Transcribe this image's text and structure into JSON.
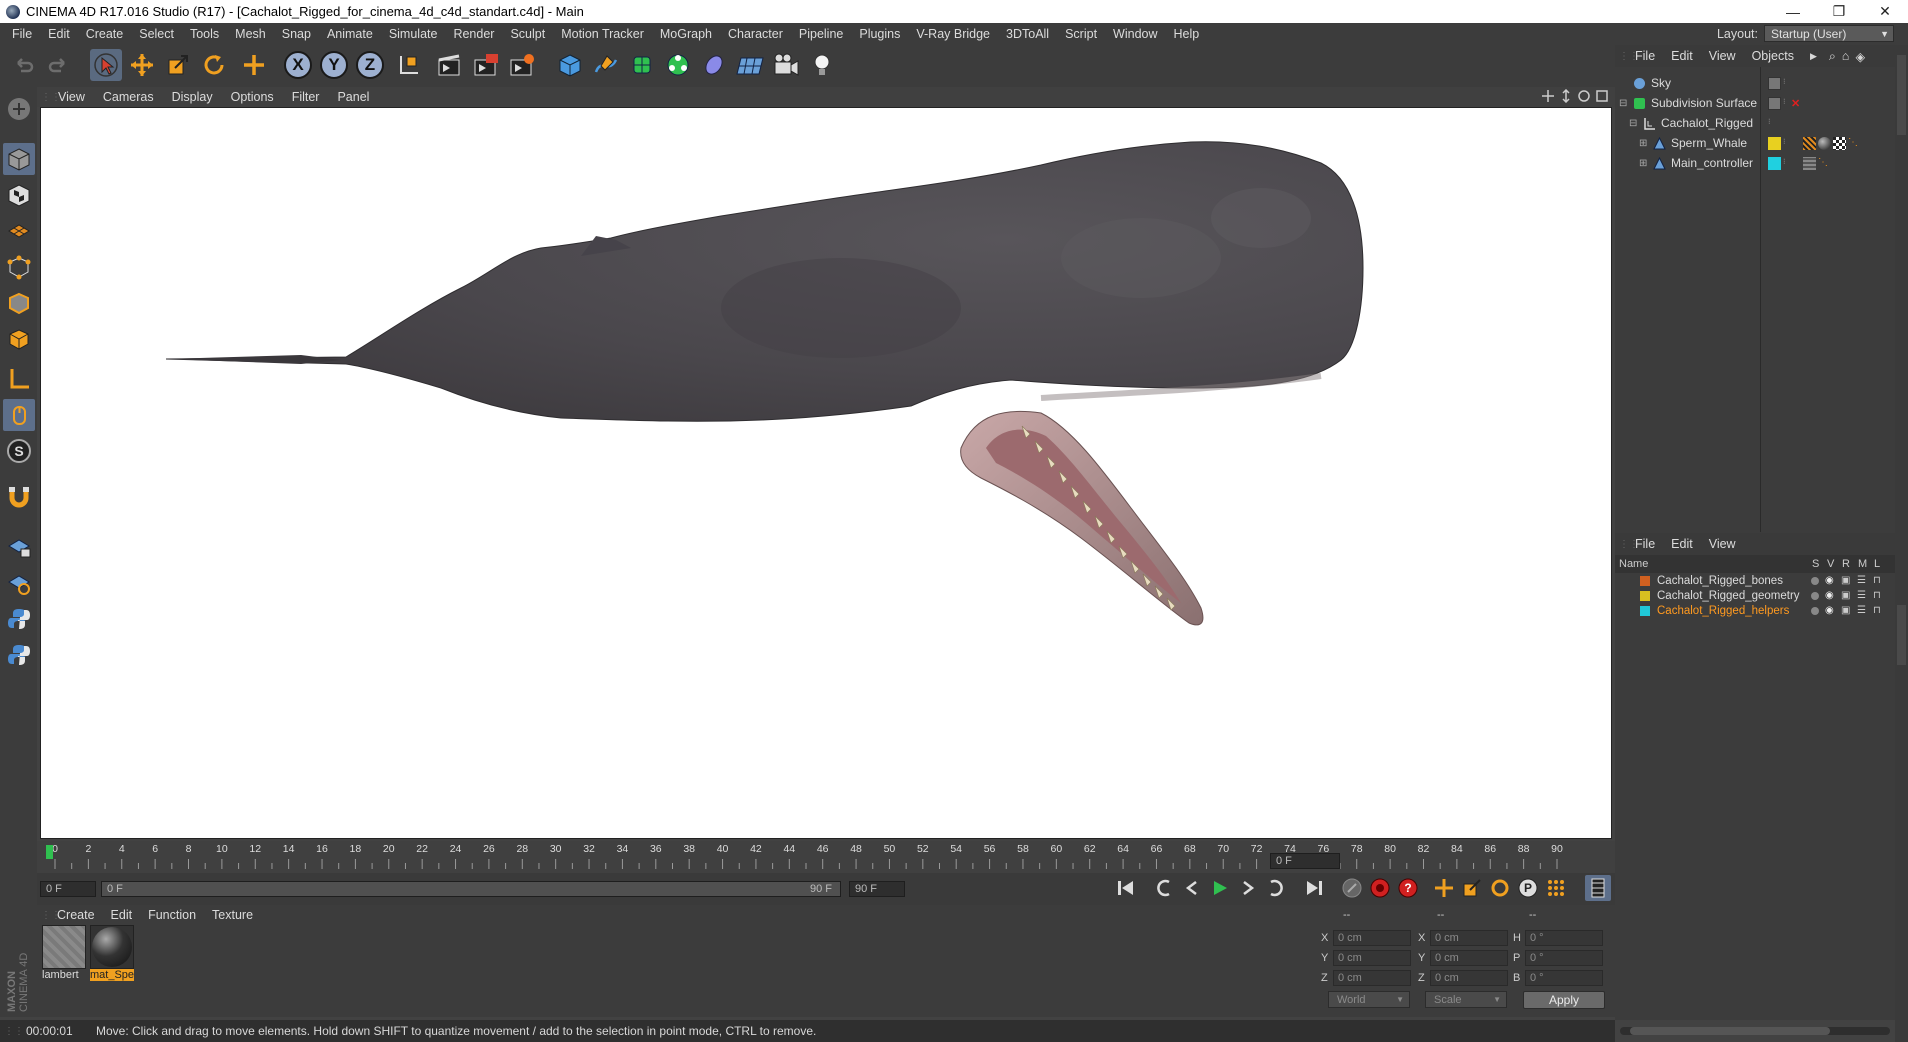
{
  "window": {
    "title": "CINEMA 4D R17.016 Studio (R17) - [Cachalot_Rigged_for_cinema_4d_c4d_standart.c4d] - Main",
    "min_glyph": "—",
    "restore_glyph": "❐",
    "close_glyph": "✕"
  },
  "menu": {
    "items": [
      "File",
      "Edit",
      "Create",
      "Select",
      "Tools",
      "Mesh",
      "Snap",
      "Animate",
      "Simulate",
      "Render",
      "Sculpt",
      "Motion Tracker",
      "MoGraph",
      "Character",
      "Pipeline",
      "Plugins",
      "V-Ray Bridge",
      "3DToAll",
      "Script",
      "Window",
      "Help"
    ],
    "layout_label": "Layout:",
    "layout_value": "Startup (User)"
  },
  "toolbar": {
    "axis_x": "X",
    "axis_y": "Y",
    "axis_z": "Z"
  },
  "viewport": {
    "menu": [
      "View",
      "Cameras",
      "Display",
      "Options",
      "Filter",
      "Panel"
    ]
  },
  "timeline": {
    "ticks": [
      "0",
      "2",
      "4",
      "6",
      "8",
      "10",
      "12",
      "14",
      "16",
      "18",
      "20",
      "22",
      "24",
      "26",
      "28",
      "30",
      "32",
      "34",
      "36",
      "38",
      "40",
      "42",
      "44",
      "46",
      "48",
      "50",
      "52",
      "54",
      "56",
      "58",
      "60",
      "62",
      "64",
      "66",
      "68",
      "70",
      "72",
      "74",
      "76",
      "78",
      "80",
      "82",
      "84",
      "86",
      "88",
      "90"
    ],
    "current_frame": "0 F",
    "start_frame": "0 F",
    "range_start": "0 F",
    "range_end": "90 F",
    "end_frame": "90 F"
  },
  "materials": {
    "menu": [
      "Create",
      "Edit",
      "Function",
      "Texture"
    ],
    "items": [
      {
        "name": "lambert",
        "selected": false
      },
      {
        "name": "mat_Spe",
        "selected": true
      }
    ]
  },
  "coordinates": {
    "header": [
      "--",
      "--",
      "--"
    ],
    "rows": [
      {
        "a": "X",
        "av": "0 cm",
        "b": "X",
        "bv": "0 cm",
        "c": "H",
        "cv": "0 °"
      },
      {
        "a": "Y",
        "av": "0 cm",
        "b": "Y",
        "bv": "0 cm",
        "c": "P",
        "cv": "0 °"
      },
      {
        "a": "Z",
        "av": "0 cm",
        "b": "Z",
        "bv": "0 cm",
        "c": "B",
        "cv": "0 °"
      }
    ],
    "mode": "World",
    "scale": "Scale",
    "apply": "Apply"
  },
  "objects": {
    "menu": [
      "File",
      "Edit",
      "View",
      "Objects"
    ],
    "items": [
      {
        "name": "Sky"
      },
      {
        "name": "Subdivision Surface"
      },
      {
        "name": "Cachalot_Rigged"
      },
      {
        "name": "Sperm_Whale"
      },
      {
        "name": "Main_controller"
      }
    ],
    "colors": {
      "sperm_whale": "#e8d020",
      "main_controller": "#20d0e0"
    }
  },
  "layers": {
    "menu": [
      "File",
      "Edit",
      "View"
    ],
    "columns": [
      "Name",
      "S",
      "V",
      "R",
      "M",
      "L"
    ],
    "items": [
      {
        "name": "Cachalot_Rigged_bones",
        "color": "#d06020",
        "text_color": "#dcdcdc"
      },
      {
        "name": "Cachalot_Rigged_geometry",
        "color": "#d8c020",
        "text_color": "#dcdcdc"
      },
      {
        "name": "Cachalot_Rigged_helpers",
        "color": "#20c8d8",
        "text_color": "#ff9a20"
      }
    ]
  },
  "status": {
    "time": "00:00:01",
    "message": "Move: Click and drag to move elements. Hold down SHIFT to quantize movement / add to the selection in point mode, CTRL to remove."
  },
  "brand": {
    "maxon": "MAXON",
    "product": "CINEMA 4D"
  }
}
